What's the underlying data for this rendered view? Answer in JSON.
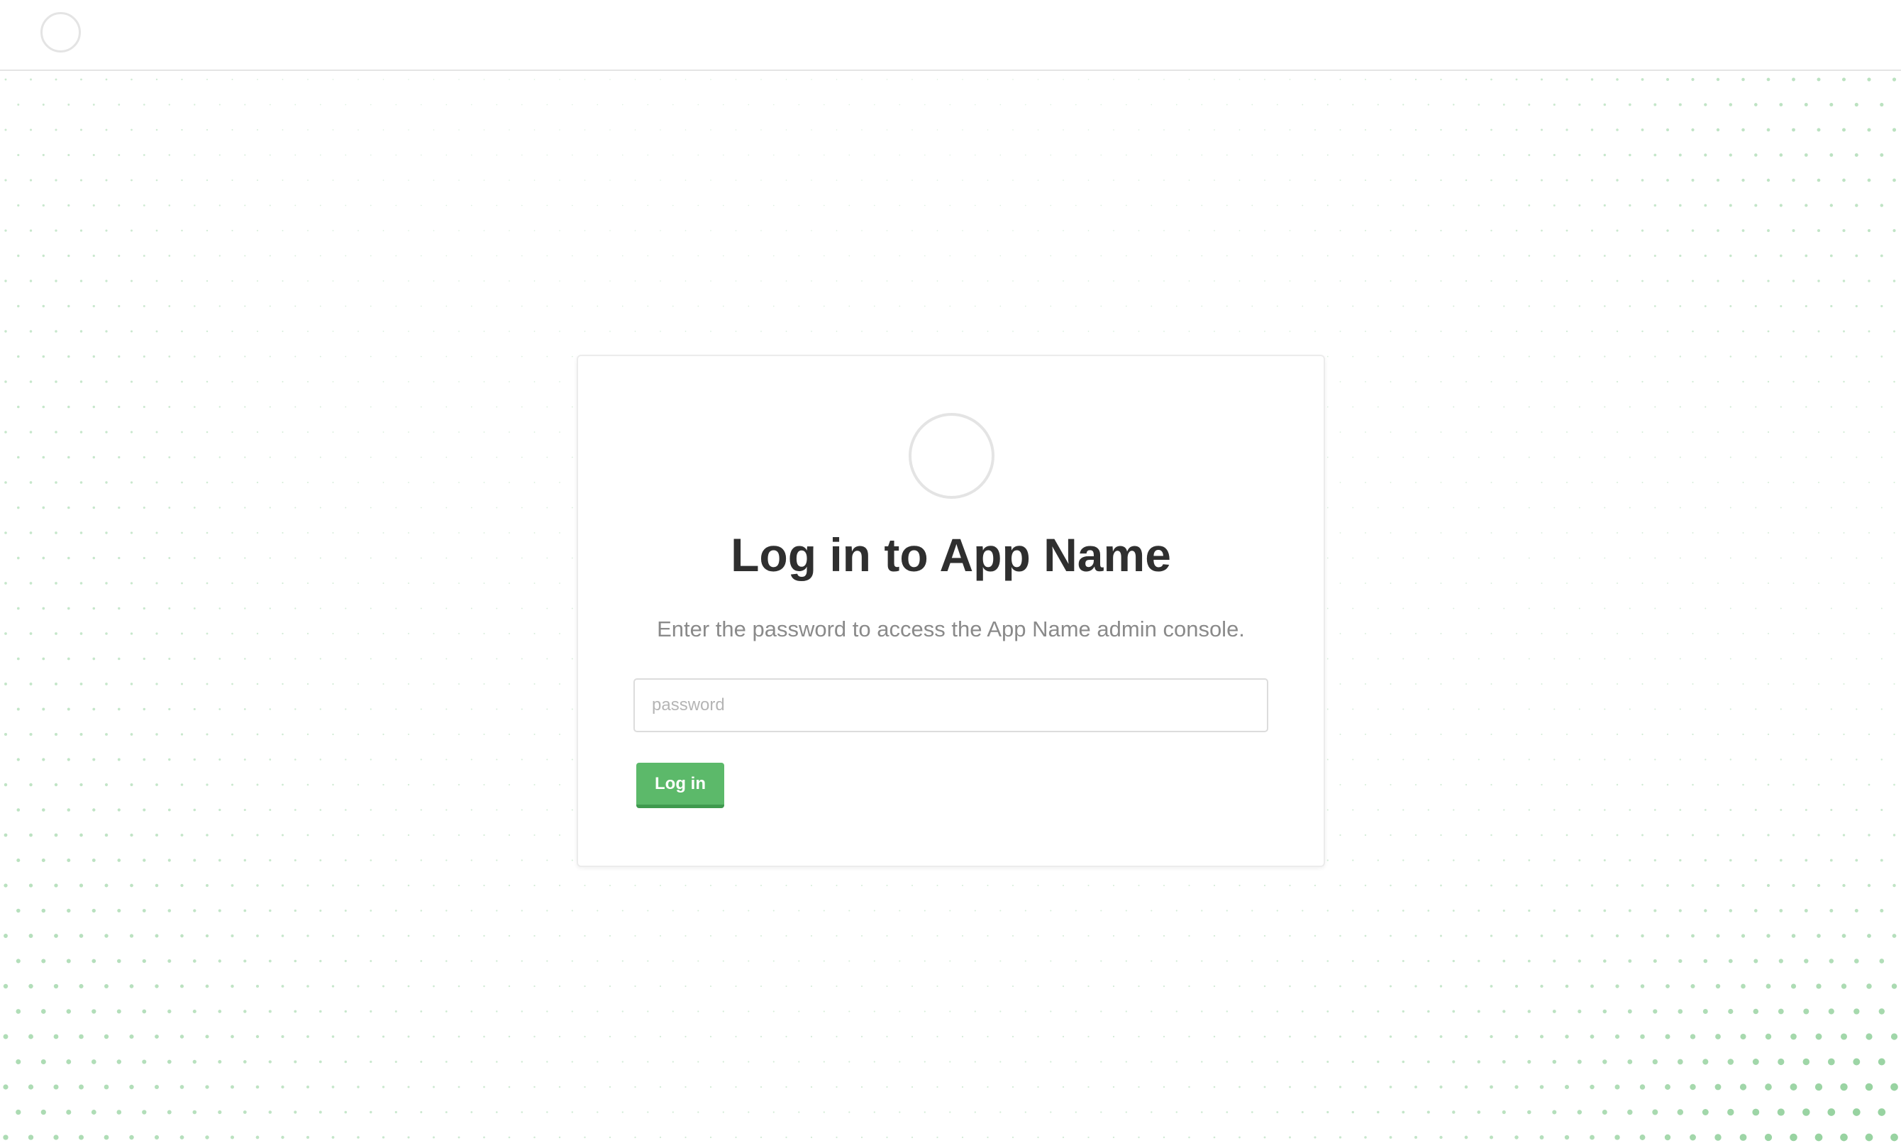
{
  "colors": {
    "accent": "#5cb96a",
    "accent_dark": "#3f9a4e",
    "dot_color": "#5cb96a",
    "title_text": "#2f2f2f",
    "subtitle_text": "#8a8a8a",
    "border": "#e4e4e4"
  },
  "header": {
    "logo_icon": "circle-logo-icon"
  },
  "login": {
    "logo_icon": "circle-logo-icon",
    "title": "Log in to App Name",
    "subtitle": "Enter the password to access the App Name admin console.",
    "password_value": "",
    "password_placeholder": "password",
    "button_label": "Log in"
  }
}
